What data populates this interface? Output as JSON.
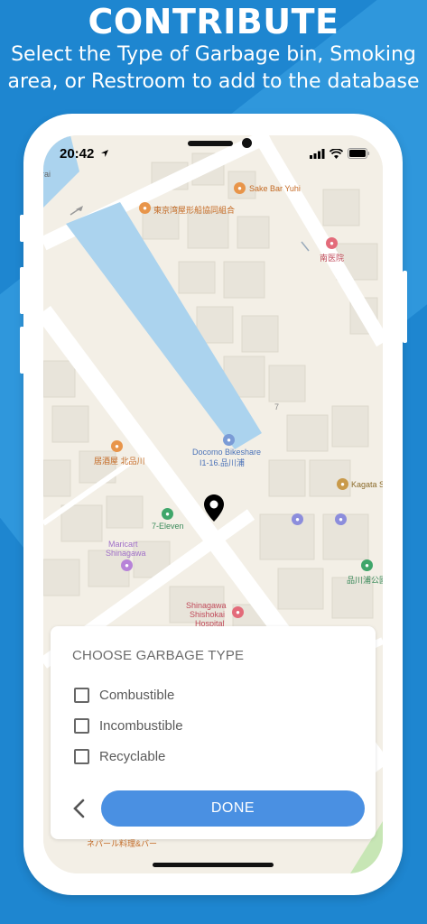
{
  "headline": {
    "title": "CONTRIBUTE",
    "subtitle_line1": "Select the Type of Garbage bin, Smoking",
    "subtitle_line2": "area, or Restroom to add to the database"
  },
  "status_bar": {
    "time": "20:42"
  },
  "map": {
    "labels": {
      "sake_bar": "Sake Bar Yuhi",
      "tokyo_wan": "東京湾屋形船協同組合",
      "minami_iin": "南医院",
      "block_number": "7",
      "docomo_line1": "Docomo Bikeshare",
      "docomo_line2": "I1-16.品川浦",
      "izakaya": "居酒屋 北品川",
      "kagata": "Kagata S",
      "seven_eleven": "7-Eleven",
      "maricart_line1": "Maricart",
      "maricart_line2": "Shinagawa",
      "park": "品川浦公園",
      "hospital_line1": "Shinagawa",
      "hospital_line2": "Shishokai",
      "hospital_line3": "Hospital",
      "nepal": "ネパール料理&バー",
      "rai": "rai"
    },
    "colors": {
      "land": "#f3efe6",
      "road": "#ffffff",
      "block": "#e8e4da",
      "water": "#abd3ee"
    }
  },
  "garbage_sheet": {
    "title": "CHOOSE GARBAGE TYPE",
    "options": [
      {
        "label": "Combustible",
        "checked": false
      },
      {
        "label": "Incombustible",
        "checked": false
      },
      {
        "label": "Recyclable",
        "checked": false
      }
    ],
    "done_label": "DONE",
    "accent_color": "#4a90e2"
  },
  "icons": [
    "location-arrow-icon",
    "signal-icon",
    "wifi-icon",
    "battery-icon",
    "map-pin-icon",
    "chevron-left-icon",
    "checkbox-icon"
  ]
}
